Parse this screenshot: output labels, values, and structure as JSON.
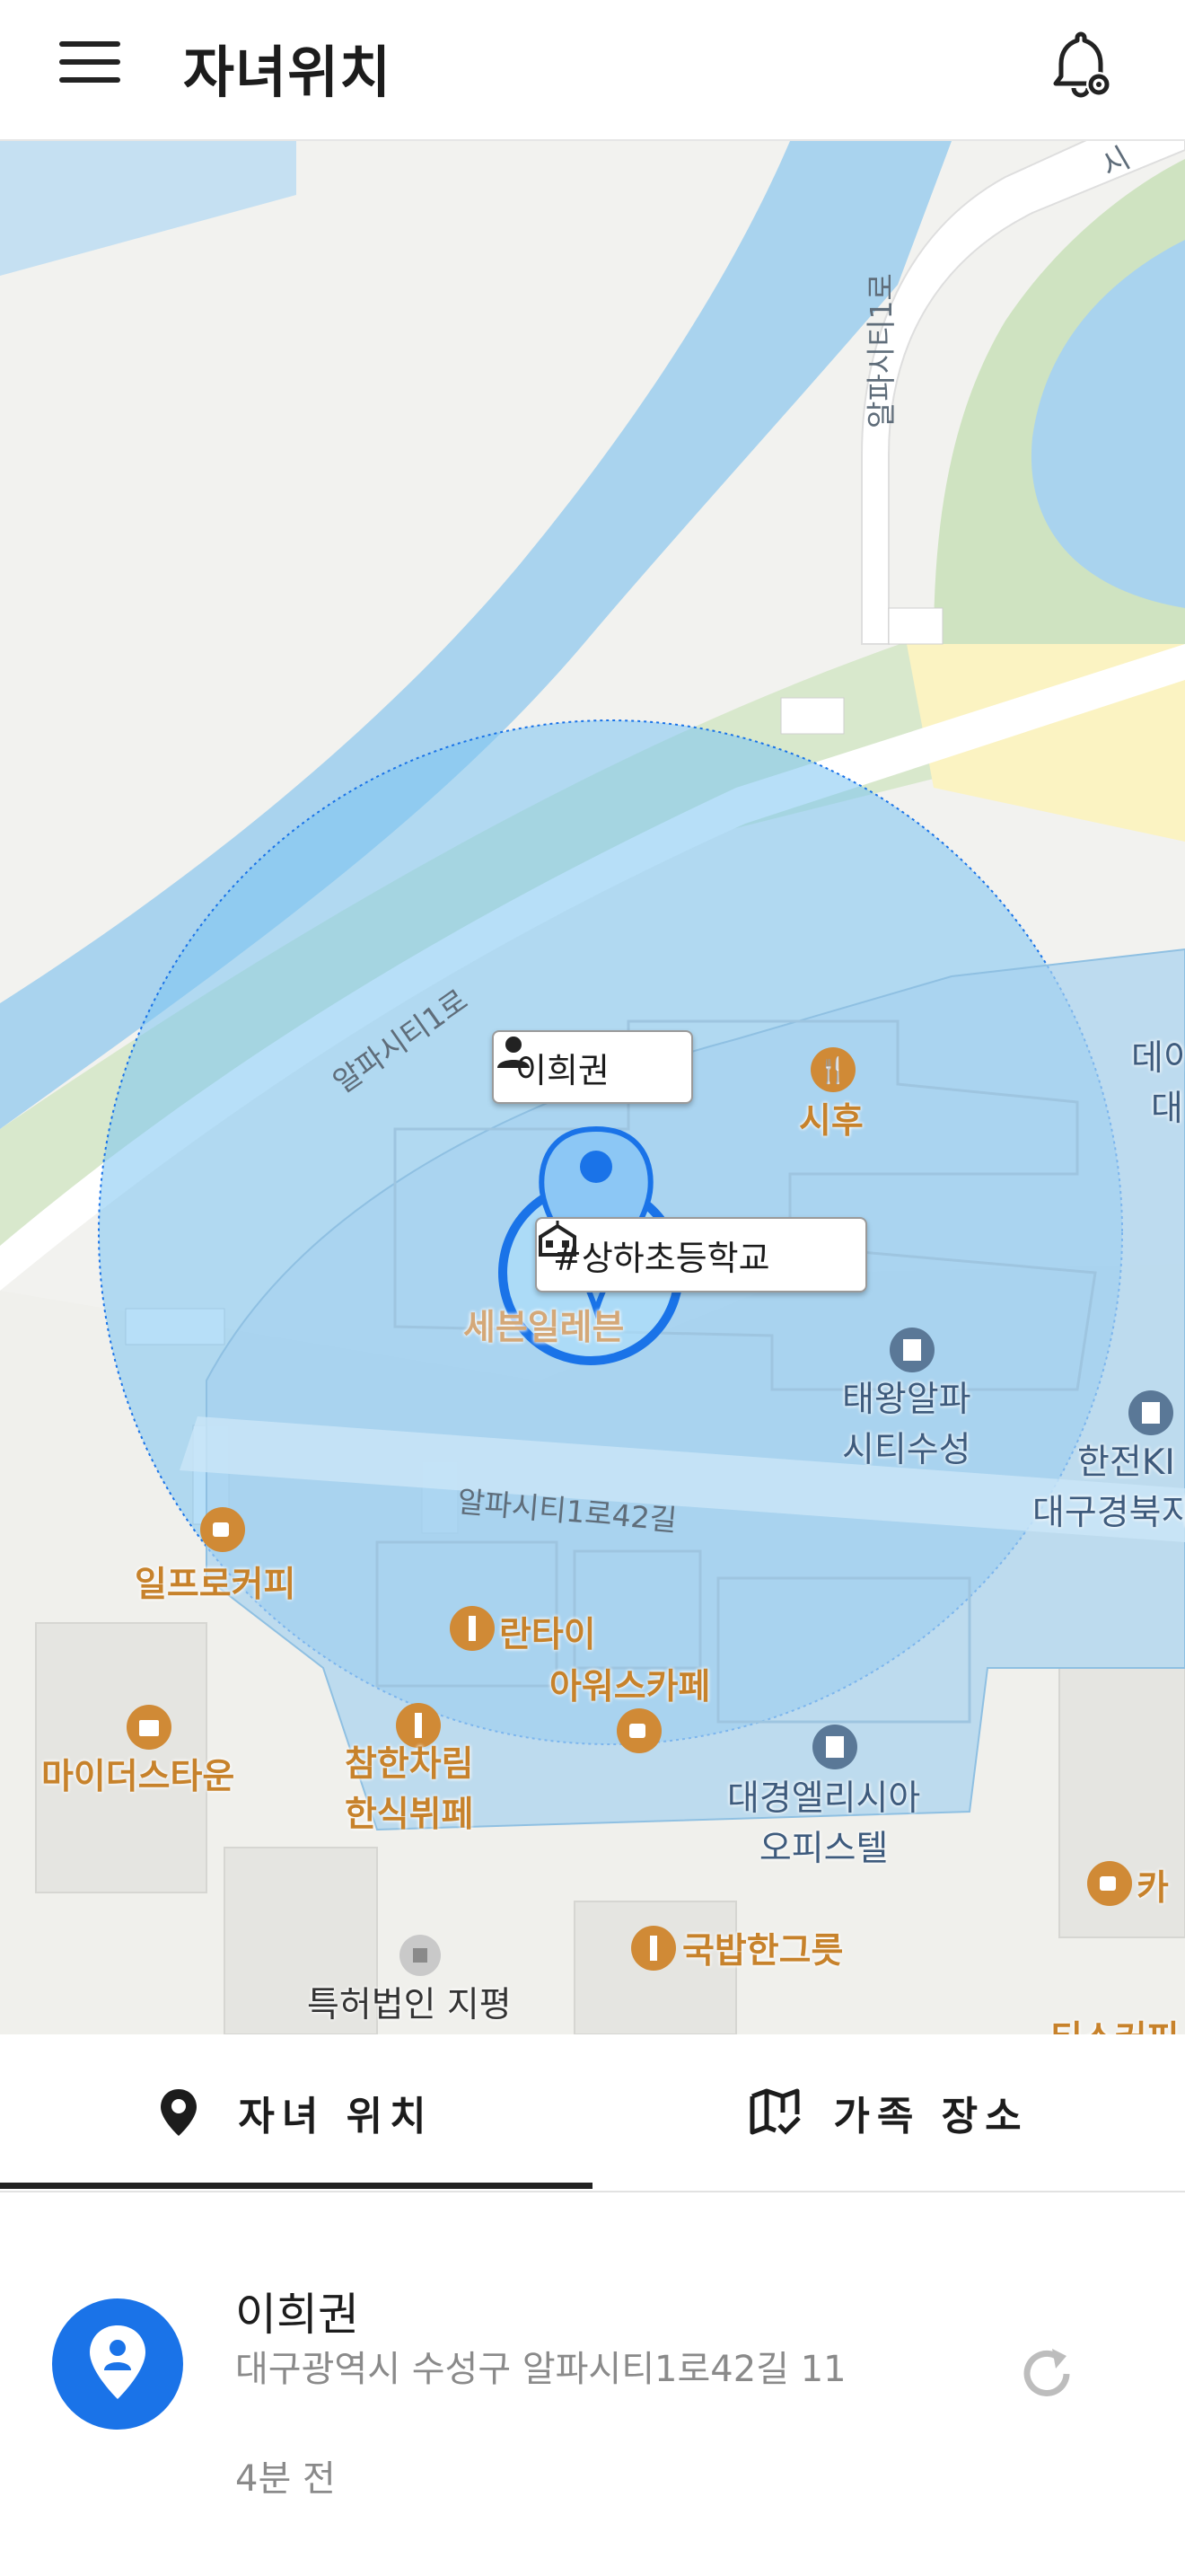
{
  "header": {
    "title": "자녀위치",
    "menu_icon": "hamburger-menu-icon",
    "settings_icon": "bell-settings-icon"
  },
  "map": {
    "markers": {
      "child_name": "이희권",
      "place_name": "#상하초등학교"
    },
    "roads": {
      "alpha_1ro_vertical": "알파시티1로",
      "alpha_1ro_diagonal": "알파시티1로",
      "alpha_1ro_42gil": "알파시티1로42길",
      "top_right_cut": "시"
    },
    "pois": {
      "sihu": "시후",
      "seven_eleven": "세븐일레븐",
      "taewang_line1": "태왕알파",
      "taewang_line2": "시티수성",
      "kepco_line1": "한전KI",
      "kepco_line2": "대구경북지",
      "right_edge_line1": "데이",
      "right_edge_line2": "대",
      "ilpro_coffee": "일프로커피",
      "lantai": "란타이",
      "awus_cafe": "아워스카페",
      "mydeo_town": "마이더스타운",
      "chamhan_line1": "참한차림",
      "chamhan_line2": "한식뷔페",
      "daekyung_line1": "대경엘리시아",
      "daekyung_line2": "오피스텔",
      "gukbap": "국밥한그릇",
      "patent_office": "특허법인 지평",
      "cafe_right": "카",
      "bottom_right_cafe": "티스커피"
    },
    "colors": {
      "geofence_fill": "#7cc4f3",
      "geofence_stroke": "#1a73e8",
      "marker_blue": "#1a73e8",
      "river": "#a9d3ee",
      "green": "#cfe3c1"
    }
  },
  "tabs": [
    {
      "label": "자녀 위치",
      "icon": "location-pin-icon",
      "active": true
    },
    {
      "label": "가족 장소",
      "icon": "map-check-icon",
      "active": false
    }
  ],
  "child_card": {
    "name": "이희권",
    "address": "대구광역시 수성구 알파시티1로42길 11",
    "time_ago": "4분 전",
    "refresh_icon": "refresh-icon"
  }
}
